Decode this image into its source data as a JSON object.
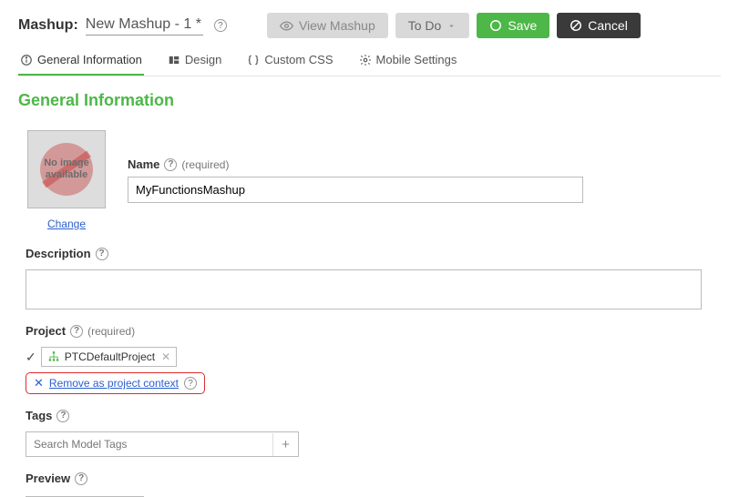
{
  "header": {
    "prefix": "Mashup:",
    "title": "New Mashup - 1 *",
    "buttons": {
      "view": "View Mashup",
      "todo": "To Do",
      "save": "Save",
      "cancel": "Cancel"
    }
  },
  "tabs": [
    {
      "label": "General Information",
      "active": true
    },
    {
      "label": "Design"
    },
    {
      "label": "Custom CSS"
    },
    {
      "label": "Mobile Settings"
    }
  ],
  "section_title": "General Information",
  "thumbnail": {
    "text": "No image available",
    "change": "Change"
  },
  "fields": {
    "name": {
      "label": "Name",
      "required": "(required)",
      "value": "MyFunctionsMashup"
    },
    "description": {
      "label": "Description",
      "value": ""
    },
    "project": {
      "label": "Project",
      "required": "(required)",
      "value": "PTCDefaultProject",
      "remove_label": "Remove as project context"
    },
    "tags": {
      "label": "Tags",
      "placeholder": "Search Model Tags"
    },
    "preview": {
      "label": "Preview"
    }
  }
}
